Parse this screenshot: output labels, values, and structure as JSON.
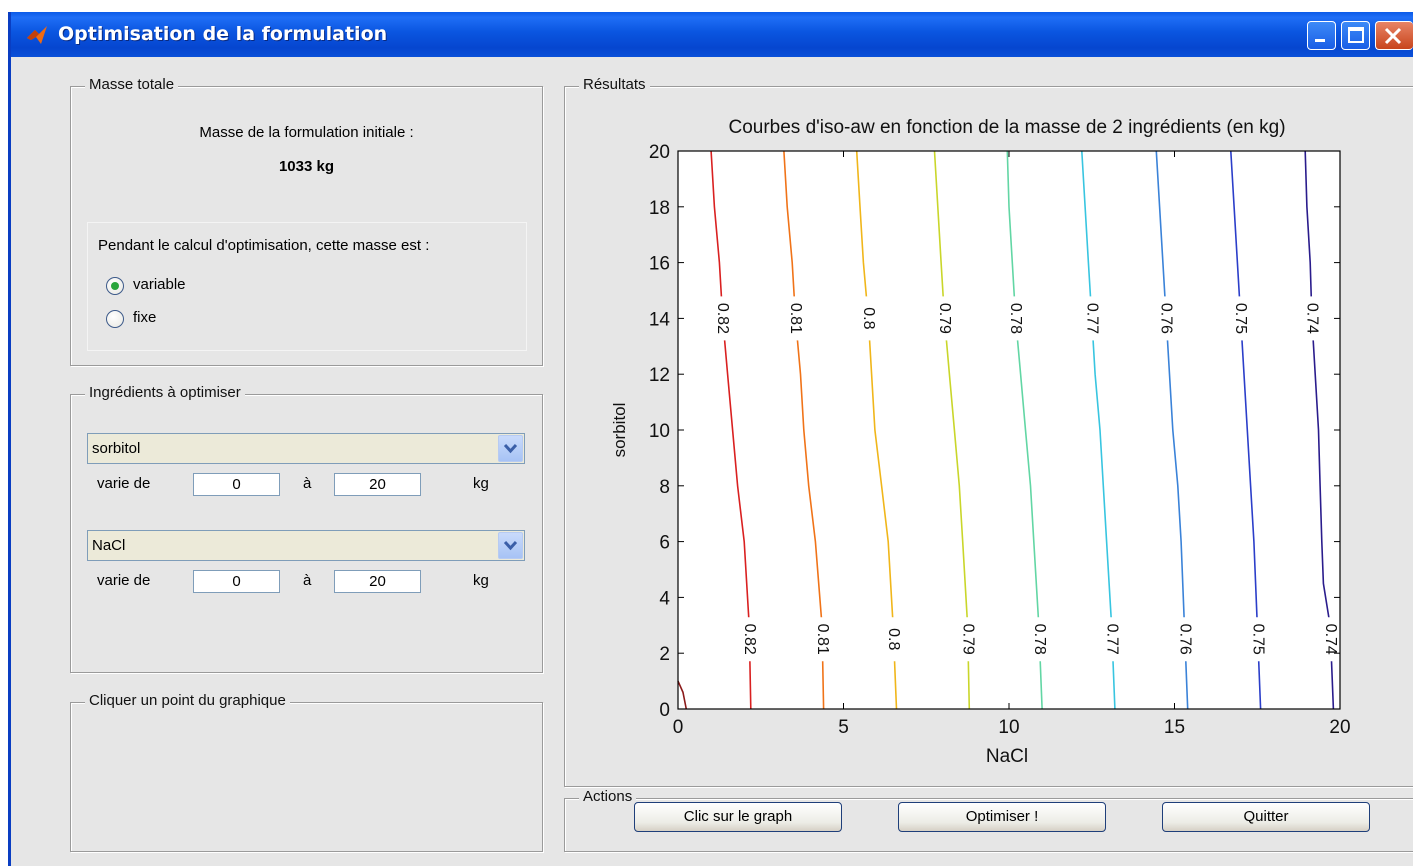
{
  "window": {
    "title": "Optimisation de la formulation"
  },
  "masse_panel": {
    "title": "Masse totale",
    "initial_label": "Masse de la formulation initiale :",
    "initial_value": "1033 kg",
    "question": "Pendant le calcul d'optimisation, cette masse est :",
    "options": [
      {
        "label": "variable",
        "selected": true
      },
      {
        "label": "fixe",
        "selected": false
      }
    ]
  },
  "ingredients_panel": {
    "title": "Ingrédients à optimiser",
    "ingredients": [
      {
        "name": "sorbitol",
        "from_label": "varie de",
        "min": "0",
        "to_label": "à",
        "max": "20",
        "unit": "kg"
      },
      {
        "name": "NaCl",
        "from_label": "varie de",
        "min": "0",
        "to_label": "à",
        "max": "20",
        "unit": "kg"
      }
    ]
  },
  "click_panel": {
    "title": "Cliquer un point du graphique"
  },
  "results_panel": {
    "title": "Résultats"
  },
  "actions_panel": {
    "title": "Actions",
    "buttons": [
      "Clic sur le graph",
      "Optimiser !",
      "Quitter"
    ]
  },
  "chart_data": {
    "type": "contour",
    "title": "Courbes d'iso-aw en fonction de la masse de 2 ingrédients (en kg)",
    "xlabel": "NaCl",
    "ylabel": "sorbitol",
    "xlim": [
      0,
      20
    ],
    "ylim": [
      0,
      20
    ],
    "xticks": [
      "0",
      "5",
      "10",
      "15",
      "20"
    ],
    "yticks": [
      "0",
      "2",
      "4",
      "6",
      "8",
      "10",
      "12",
      "14",
      "16",
      "18",
      "20"
    ],
    "grid": false,
    "contours": [
      {
        "level": "0.82",
        "color": "#d92020",
        "x_at_y": [
          [
            0,
            2.2
          ],
          [
            3,
            2.15
          ],
          [
            6,
            2.0
          ],
          [
            8,
            1.8
          ],
          [
            10,
            1.65
          ],
          [
            12,
            1.5
          ],
          [
            14,
            1.35
          ],
          [
            16,
            1.25
          ],
          [
            18,
            1.1
          ],
          [
            20,
            1.0
          ]
        ]
      },
      {
        "level": "0.81",
        "color": "#f07318",
        "x_at_y": [
          [
            0,
            4.4
          ],
          [
            3,
            4.35
          ],
          [
            6,
            4.15
          ],
          [
            8,
            3.95
          ],
          [
            10,
            3.8
          ],
          [
            12,
            3.7
          ],
          [
            14,
            3.55
          ],
          [
            16,
            3.45
          ],
          [
            18,
            3.3
          ],
          [
            20,
            3.2
          ]
        ]
      },
      {
        "level": "0.8",
        "color": "#f0b61a",
        "x_at_y": [
          [
            0,
            6.6
          ],
          [
            3,
            6.5
          ],
          [
            6,
            6.35
          ],
          [
            8,
            6.15
          ],
          [
            10,
            5.95
          ],
          [
            12,
            5.85
          ],
          [
            14,
            5.75
          ],
          [
            16,
            5.6
          ],
          [
            18,
            5.5
          ],
          [
            20,
            5.4
          ]
        ]
      },
      {
        "level": "0.79",
        "color": "#c9d62a",
        "x_at_y": [
          [
            0,
            8.8
          ],
          [
            3,
            8.75
          ],
          [
            6,
            8.6
          ],
          [
            8,
            8.5
          ],
          [
            10,
            8.35
          ],
          [
            12,
            8.2
          ],
          [
            14,
            8.05
          ],
          [
            16,
            7.95
          ],
          [
            18,
            7.85
          ],
          [
            20,
            7.75
          ]
        ]
      },
      {
        "level": "0.78",
        "color": "#62d6a4",
        "x_at_y": [
          [
            0,
            11.0
          ],
          [
            3,
            10.9
          ],
          [
            6,
            10.75
          ],
          [
            8,
            10.65
          ],
          [
            10,
            10.5
          ],
          [
            12,
            10.35
          ],
          [
            14,
            10.2
          ],
          [
            16,
            10.1
          ],
          [
            18,
            10.0
          ],
          [
            20,
            9.95
          ]
        ]
      },
      {
        "level": "0.77",
        "color": "#38c5e0",
        "x_at_y": [
          [
            0,
            13.2
          ],
          [
            3,
            13.1
          ],
          [
            6,
            12.95
          ],
          [
            8,
            12.85
          ],
          [
            10,
            12.75
          ],
          [
            12,
            12.6
          ],
          [
            14,
            12.5
          ],
          [
            16,
            12.4
          ],
          [
            18,
            12.3
          ],
          [
            20,
            12.2
          ]
        ]
      },
      {
        "level": "0.76",
        "color": "#3a82d8",
        "x_at_y": [
          [
            0,
            15.4
          ],
          [
            3,
            15.3
          ],
          [
            6,
            15.2
          ],
          [
            8,
            15.1
          ],
          [
            10,
            14.95
          ],
          [
            12,
            14.85
          ],
          [
            14,
            14.75
          ],
          [
            16,
            14.65
          ],
          [
            18,
            14.55
          ],
          [
            20,
            14.45
          ]
        ]
      },
      {
        "level": "0.75",
        "color": "#2b3ec9",
        "x_at_y": [
          [
            0,
            17.6
          ],
          [
            3,
            17.5
          ],
          [
            6,
            17.4
          ],
          [
            8,
            17.3
          ],
          [
            10,
            17.2
          ],
          [
            12,
            17.1
          ],
          [
            14,
            17.0
          ],
          [
            16,
            16.9
          ],
          [
            18,
            16.8
          ],
          [
            20,
            16.7
          ]
        ]
      },
      {
        "level": "0.74",
        "color": "#2a1c8c",
        "x_at_y": [
          [
            0,
            19.8
          ],
          [
            3,
            19.7
          ],
          [
            4.5,
            19.5
          ],
          [
            6,
            19.45
          ],
          [
            8,
            19.4
          ],
          [
            10,
            19.35
          ],
          [
            12,
            19.25
          ],
          [
            14,
            19.15
          ],
          [
            16,
            19.1
          ],
          [
            18,
            19.0
          ],
          [
            20,
            18.95
          ]
        ]
      }
    ],
    "labels_y": [
      14,
      2.5
    ],
    "corner_mark": {
      "color": "#8b1a1a"
    }
  }
}
